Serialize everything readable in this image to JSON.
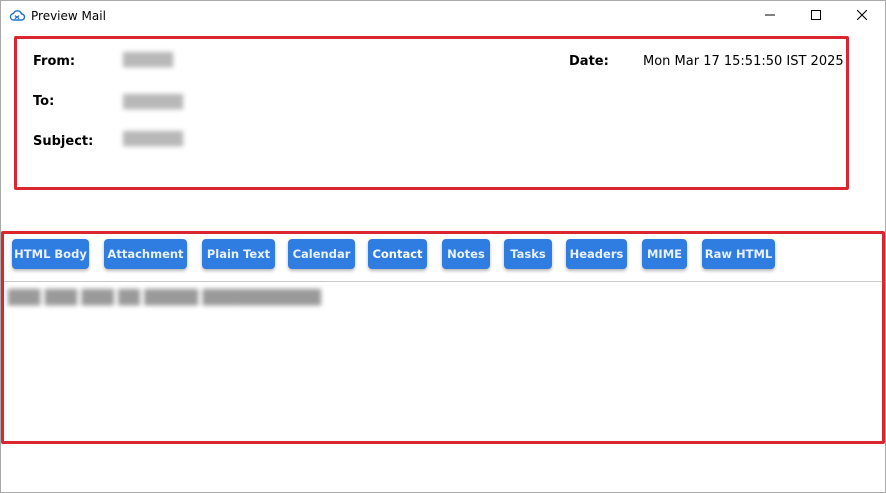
{
  "window": {
    "title": "Preview Mail"
  },
  "header": {
    "from_label": "From:",
    "from_value": "█████",
    "to_label": "To:",
    "to_value": "██████",
    "subject_label": "Subject:",
    "subject_value": "██████",
    "date_label": "Date:",
    "date_value": "Mon Mar 17 15:51:50 IST 2025"
  },
  "tabs": [
    {
      "label": "HTML Body"
    },
    {
      "label": "Attachment"
    },
    {
      "label": "Plain Text"
    },
    {
      "label": "Calendar"
    },
    {
      "label": "Contact"
    },
    {
      "label": "Notes"
    },
    {
      "label": "Tasks"
    },
    {
      "label": "Headers"
    },
    {
      "label": "MIME"
    },
    {
      "label": "Raw HTML"
    }
  ],
  "active_tab": "Contact",
  "body": {
    "text": "███ ███ ███ ██ █████ ███████████"
  },
  "colors": {
    "accent": "#2f7de1",
    "highlight_border": "#d9262f"
  },
  "icons": {
    "app": "cloud-mail-icon",
    "minimize": "minimize-icon",
    "maximize": "maximize-icon",
    "close": "close-icon"
  }
}
